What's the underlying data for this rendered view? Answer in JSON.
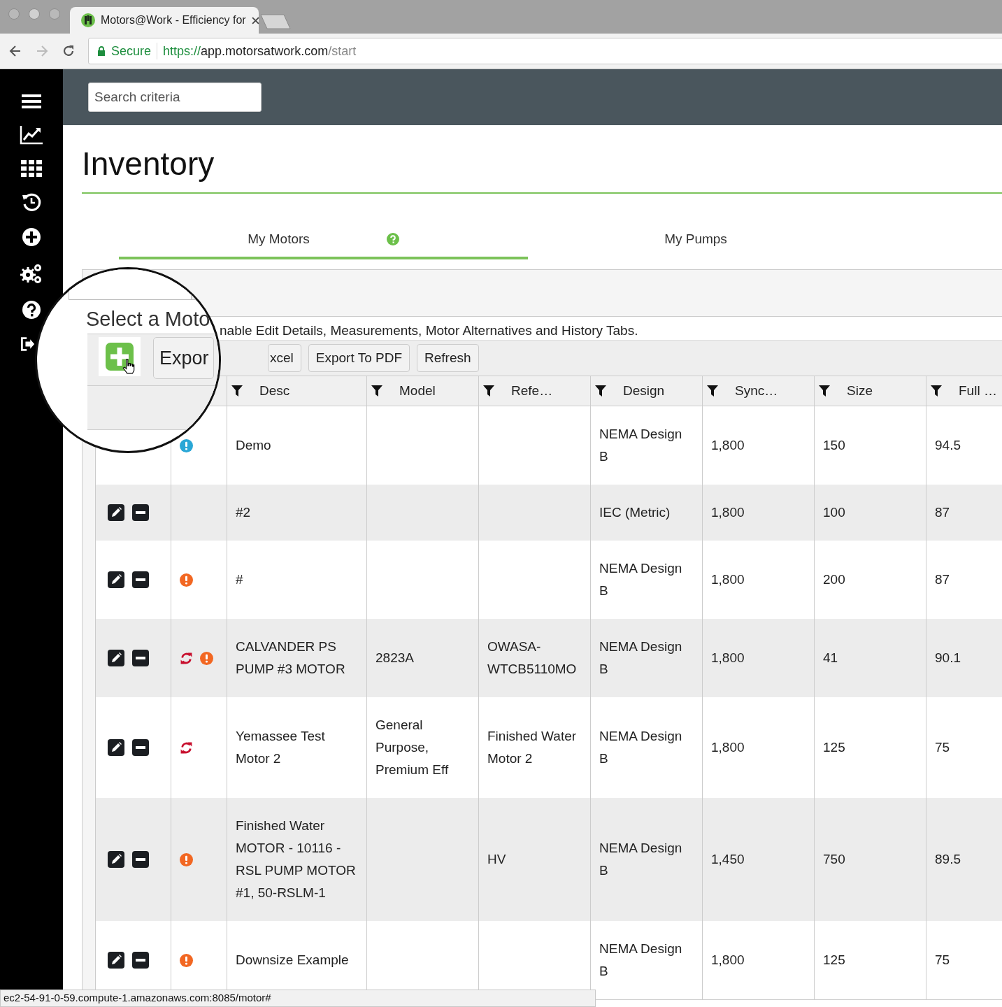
{
  "browser": {
    "tab_title": "Motors@Work - Efficiency for",
    "security": "Secure",
    "url_scheme": "https://",
    "url_host": "app.motorsatwork.com",
    "url_path": "/start"
  },
  "search": {
    "placeholder": "Search criteria"
  },
  "page_title": "Inventory",
  "tabs": [
    {
      "label": "My Motors",
      "selected": true,
      "help": true
    },
    {
      "label": "My Pumps",
      "selected": false,
      "help": false
    }
  ],
  "magnifier": {
    "heading": "Select a Moto",
    "button": "Expor"
  },
  "hint": "nable Edit Details, Measurements, Motor Alternatives and History Tabs.",
  "toolbar": [
    "xcel",
    "Export To PDF",
    "Refresh"
  ],
  "table": {
    "columns": [
      "Desc",
      "Model",
      "Refe…",
      "Design",
      "Sync…",
      "Size",
      "Full …"
    ],
    "rows": [
      {
        "actions": false,
        "status_icons": [
          {
            "kind": "info"
          }
        ],
        "cells": [
          "Demo",
          "",
          "",
          "NEMA Design B",
          "1,800",
          "150",
          "94.5"
        ]
      },
      {
        "actions": true,
        "status_icons": [],
        "cells": [
          "#2",
          "",
          "",
          "IEC (Metric)",
          "1,800",
          "100",
          "87"
        ]
      },
      {
        "actions": true,
        "status_icons": [
          {
            "kind": "warning"
          }
        ],
        "cells": [
          "#",
          "",
          "",
          "NEMA Design B",
          "1,800",
          "200",
          "87"
        ]
      },
      {
        "actions": true,
        "status_icons": [
          {
            "kind": "sync"
          },
          {
            "kind": "warning"
          }
        ],
        "cells": [
          "CALVANDER PS PUMP #3 MOTOR",
          "2823A",
          "OWASA-WTCB5110MO",
          "NEMA Design B",
          "1,800",
          "41",
          "90.1"
        ]
      },
      {
        "actions": true,
        "status_icons": [
          {
            "kind": "sync"
          }
        ],
        "cells": [
          "Yemassee Test Motor 2",
          "General Purpose, Premium Eff",
          "Finished Water Motor 2",
          "NEMA Design B",
          "1,800",
          "125",
          "75"
        ]
      },
      {
        "actions": true,
        "status_icons": [
          {
            "kind": "warning"
          }
        ],
        "cells": [
          "Finished Water MOTOR - 10116 - RSL PUMP MOTOR #1, 50-RSLM-1",
          "",
          "HV",
          "NEMA Design B",
          "1,450",
          "750",
          "89.5"
        ]
      },
      {
        "actions": true,
        "status_icons": [
          {
            "kind": "warning"
          }
        ],
        "cells": [
          "Downsize Example",
          "",
          "",
          "NEMA Design B",
          "1,800",
          "125",
          "75"
        ]
      }
    ]
  },
  "status_bar": "ec2-54-91-0-59.compute-1.amazonaws.com:8085/motor#"
}
